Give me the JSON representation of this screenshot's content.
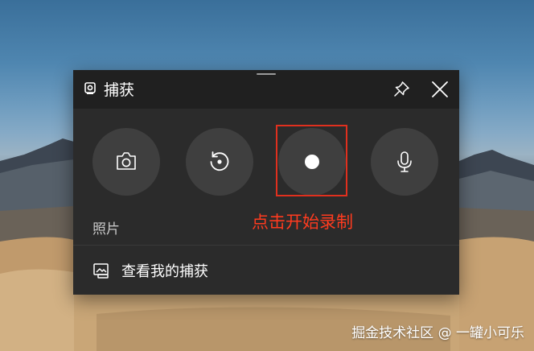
{
  "capture_widget": {
    "title": "捕获",
    "buttons": {
      "screenshot_icon": "camera-icon",
      "recent_icon": "replay-icon",
      "record_icon": "record-icon",
      "mic_icon": "microphone-icon"
    },
    "photo_label": "照片",
    "annotation_text": "点击开始录制",
    "gallery_link_label": "查看我的捕获"
  },
  "watermark": "掘金技术社区 @ 一罐小可乐",
  "colors": {
    "panel_bg": "#2b2b2b",
    "titlebar_bg": "#202020",
    "button_bg": "#3f3f3f",
    "annotation_red": "#e0301e"
  }
}
